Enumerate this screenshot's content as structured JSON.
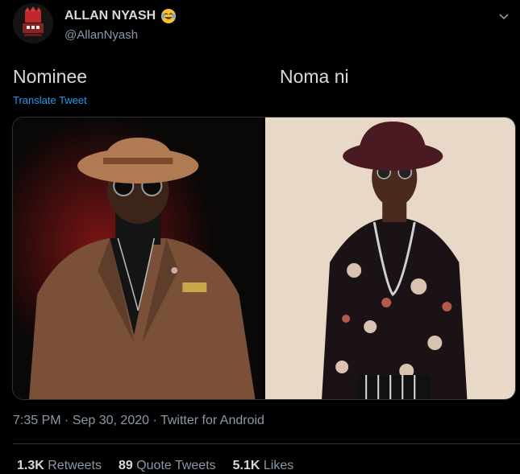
{
  "author": {
    "display_name": "ALLAN NYASH",
    "emoji_icon": "tears-of-joy-icon",
    "handle": "@AllanNyash"
  },
  "tweet": {
    "text_left": "Nominee",
    "text_right": "Noma ni",
    "translate_label": "Translate Tweet",
    "media": [
      {
        "description_icon": "photo-man-brown-suit-hat"
      },
      {
        "description_icon": "photo-man-floral-shirt-hat"
      }
    ]
  },
  "meta": {
    "time": "7:35 PM",
    "separator": "·",
    "date": "Sep 30, 2020",
    "source": "Twitter for Android"
  },
  "stats": {
    "retweets_count": "1.3K",
    "retweets_label": "Retweets",
    "quotes_count": "89",
    "quotes_label": "Quote Tweets",
    "likes_count": "5.1K",
    "likes_label": "Likes"
  },
  "colors": {
    "background": "#000000",
    "link": "#1d9bf0",
    "secondary_text": "#8b98a5",
    "primary_text": "#d9d9d9"
  }
}
